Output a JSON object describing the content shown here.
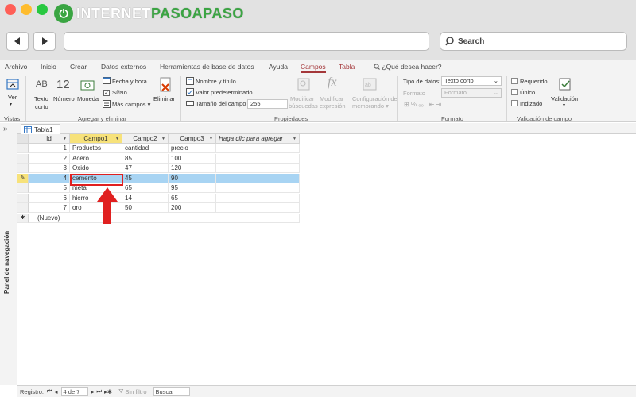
{
  "brand": {
    "name_left": "INTERNET",
    "name_right": "PASOAPASO"
  },
  "browser": {
    "search_placeholder": "Search",
    "url": ""
  },
  "ribbon_tabs": [
    "Archivo",
    "Inicio",
    "Crear",
    "Datos externos",
    "Herramientas de base de datos",
    "Ayuda",
    "Campos",
    "Tabla",
    "¿Qué desea hacer?"
  ],
  "active_tab": "Campos",
  "ribbon": {
    "vistas": {
      "ver_label": "Ver",
      "group_title": "Vistas"
    },
    "agregar": {
      "texto_corto": "Texto corto",
      "numero": "Número",
      "moneda": "Moneda",
      "fecha_hora": "Fecha y hora",
      "si_no": "Sí/No",
      "mas_campos": "Más campos",
      "eliminar": "Eliminar",
      "group_title": "Agregar y eliminar",
      "ab_glyph": "AB",
      "num_glyph": "12"
    },
    "propiedades": {
      "nombre_titulo": "Nombre y título",
      "valor_pred": "Valor predeterminado",
      "tamano_label": "Tamaño del campo",
      "tamano_value": "255",
      "mod_busquedas": "Modificar búsquedas",
      "mod_expresion": "Modificar expresión",
      "config_memo": "Configuración de memorando",
      "group_title": "Propiedades"
    },
    "formato": {
      "tipo_label": "Tipo de datos:",
      "tipo_value": "Texto corto",
      "formato_label": "Formato",
      "formato_value": "Formato",
      "group_title": "Formato"
    },
    "validacion": {
      "requerido": "Requerido",
      "unico": "Único",
      "indizado": "Indizado",
      "validacion_btn": "Validación",
      "group_title": "Validación de campo"
    }
  },
  "nav_pane": {
    "label": "Panel de navegación",
    "toggle": "»"
  },
  "doc_tab": {
    "name": "Tabla1"
  },
  "table": {
    "columns": [
      "Id",
      "Campo1",
      "Campo2",
      "Campo3",
      "Haga clic para agregar"
    ],
    "rows": [
      {
        "id": "1",
        "c1": "Productos",
        "c2": "cantidad",
        "c3": "precio"
      },
      {
        "id": "2",
        "c1": "Acero",
        "c2": "85",
        "c3": "100"
      },
      {
        "id": "3",
        "c1": "Oxido",
        "c2": "47",
        "c3": "120"
      },
      {
        "id": "4",
        "c1": "cemento",
        "c2": "45",
        "c3": "90"
      },
      {
        "id": "5",
        "c1": "metal",
        "c2": "65",
        "c3": "95"
      },
      {
        "id": "6",
        "c1": "hierro",
        "c2": "14",
        "c3": "65"
      },
      {
        "id": "7",
        "c1": "oro",
        "c2": "50",
        "c3": "200"
      }
    ],
    "new_row": "(Nuevo)",
    "current_row_index": 3
  },
  "status": {
    "registro_label": "Registro:",
    "position": "4 de 7",
    "filter": "Sin filtro",
    "search": "Buscar"
  },
  "colors": {
    "accent": "#a4373a",
    "selected_header": "#f7e27a",
    "selected_row": "#a8d4f3",
    "highlight": "#e02020",
    "brand_green": "#3aa542"
  }
}
